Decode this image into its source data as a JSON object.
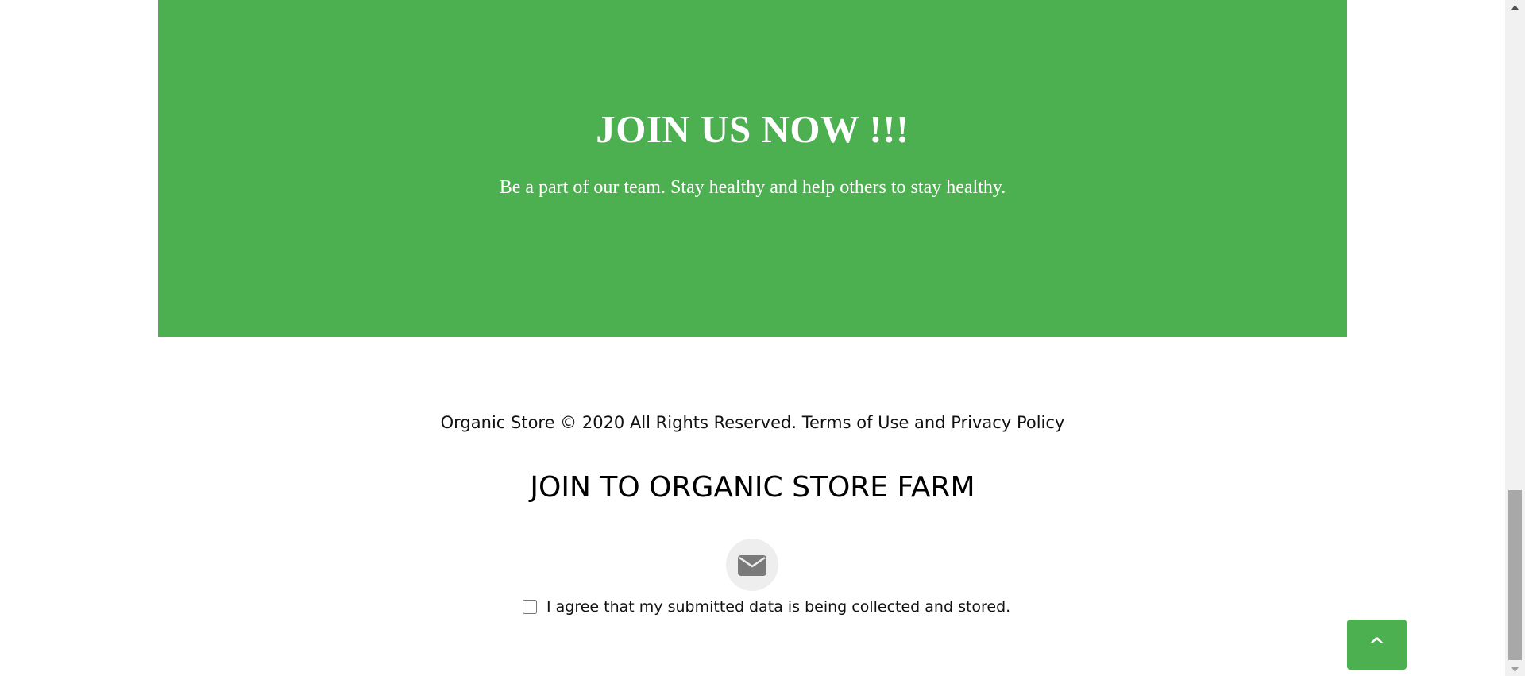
{
  "banner": {
    "title": "JOIN US NOW !!!",
    "text": "Be a part of our team. Stay healthy and help others to stay healthy.",
    "background_color": "#4caf50"
  },
  "footer": {
    "copyright_prefix": "Organic Store © 2020 All Rights Reserved. ",
    "terms_label": "Terms of Use",
    "and_text": " and ",
    "privacy_label": "Privacy Policy"
  },
  "newsletter": {
    "title": "JOIN TO ORGANIC STORE FARM",
    "icon": "envelope-icon",
    "consent_label": "I agree that my submitted data is being collected and stored."
  },
  "back_to_top": {
    "label": "^",
    "background_color": "#4caf50"
  },
  "scrollbar": {
    "up_icon": "arrow-up-icon",
    "down_icon": "arrow-down-icon"
  }
}
